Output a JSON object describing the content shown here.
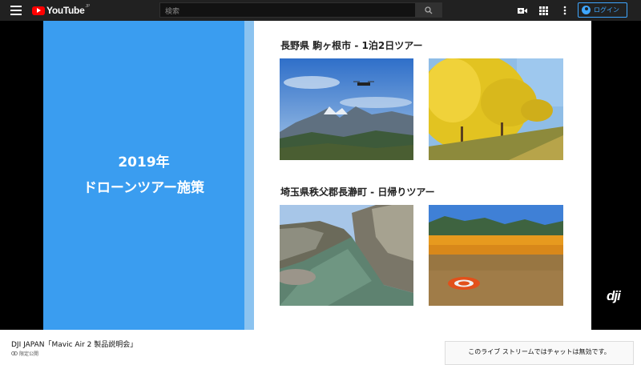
{
  "header": {
    "logo_text": "YouTube",
    "logo_country": "JP",
    "search_placeholder": "検索",
    "login_label": "ログイン",
    "icons": [
      "menu-icon",
      "search-icon",
      "create-video-icon",
      "apps-icon",
      "more-vert-icon",
      "account-icon"
    ]
  },
  "slide": {
    "title_line1": "2019年",
    "title_line2": "ドローンツアー施策",
    "section1_title": "長野県 駒ヶ根市 - 1泊2日ツアー",
    "section2_title": "埼玉県秩父郡長瀞町 - 日帰りツアー",
    "photos": [
      "mountain-drone-photo",
      "ginkgo-trees-photo",
      "river-gorge-photo",
      "flower-field-landing-pad-photo"
    ],
    "colors": {
      "left_panel": "#3a9df0",
      "stripe": "#8bc3f0"
    }
  },
  "watermark": "dji",
  "video": {
    "title": "DJI JAPAN「Mavic Air 2 製品説明会」",
    "visibility": "限定公開"
  },
  "chat": {
    "disabled_message": "このライブ ストリームではチャットは無効です。"
  }
}
